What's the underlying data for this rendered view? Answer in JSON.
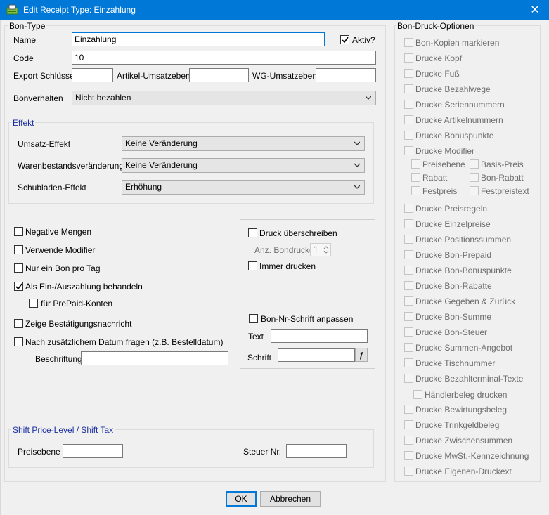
{
  "window": {
    "title": "Edit Receipt Type: Einzahlung",
    "close_glyph": "✕"
  },
  "bon_type": {
    "legend": "Bon-Type",
    "name_label": "Name",
    "name_value": "Einzahlung",
    "aktiv_label": "Aktiv?",
    "aktiv_checked": true,
    "code_label": "Code",
    "code_value": "10",
    "export_label": "Export Schlüssel",
    "export_value": "",
    "artikel_label": "Artikel-Umsatzebene",
    "artikel_value": "",
    "wg_label": "WG-Umsatzebene",
    "wg_value": "",
    "bonverhalten_label": "Bonverhalten",
    "bonverhalten_value": "Nicht bezahlen"
  },
  "effekt": {
    "legend": "Effekt",
    "umsatz_label": "Umsatz-Effekt",
    "umsatz_value": "Keine Veränderung",
    "waren_label": "Warenbestandsveränderung",
    "waren_value": "Keine Veränderung",
    "schub_label": "Schubladen-Effekt",
    "schub_value": "Erhöhung"
  },
  "options": {
    "negative": "Negative Mengen",
    "modifier": "Verwende Modifier",
    "nur_ein_bon": "Nur ein Bon pro Tag",
    "als_ein": "Als Ein-/Auszahlung behandeln",
    "prepaid": "für PrePaid-Konten",
    "zeige": "Zeige Bestätigungsnachricht",
    "datum": "Nach zusätzlichem Datum fragen (z.B. Bestelldatum)",
    "beschriftung_label": "Beschriftung",
    "beschriftung_value": ""
  },
  "druck": {
    "ueberschreiben": "Druck überschreiben",
    "anz_label": "Anz. Bondrucke",
    "anz_value": "1",
    "immer": "Immer drucken"
  },
  "bonnr": {
    "anpassen": "Bon-Nr-Schrift anpassen",
    "text_label": "Text",
    "text_value": "",
    "schrift_label": "Schrift",
    "schrift_value": "",
    "font_btn": "f"
  },
  "shift": {
    "legend": "Shift Price-Level / Shift Tax",
    "preis_label": "Preisebene",
    "preis_value": "",
    "steuer_label": "Steuer Nr.",
    "steuer_value": ""
  },
  "druck_optionen": {
    "legend": "Bon-Druck-Optionen",
    "items_a": [
      "Bon-Kopien markieren",
      "Drucke Kopf",
      "Drucke Fuß",
      "Drucke Bezahlwege",
      "Drucke Seriennummern",
      "Drucke Artikelnummern",
      "Drucke Bonuspunkte",
      "Drucke Modifier"
    ],
    "sub_left": [
      "Preisebene",
      "Rabatt",
      "Festpreis"
    ],
    "sub_right": [
      "Basis-Preis",
      "Bon-Rabatt",
      "Festpreistext"
    ],
    "items_b": [
      "Drucke Preisregeln",
      "Drucke Einzelpreise",
      "Drucke Positionssummen",
      "Drucke Bon-Prepaid",
      "Drucke Bon-Bonuspunkte",
      "Drucke Bon-Rabatte",
      "Drucke Gegeben & Zurück",
      "Drucke Bon-Summe",
      "Drucke Bon-Steuer",
      "Drucke Summen-Angebot",
      "Drucke Tischnummer",
      "Drucke Bezahlterminal-Texte"
    ],
    "haendler": "Händlerbeleg drucken",
    "items_c": [
      "Drucke Bewirtungsbeleg",
      "Drucke Trinkgeldbeleg",
      "Drucke Zwischensummen",
      "Drucke MwSt.-Kennzeichnung",
      "Drucke Eigenen-Druckext"
    ]
  },
  "buttons": {
    "ok": "OK",
    "cancel": "Abbrechen"
  }
}
